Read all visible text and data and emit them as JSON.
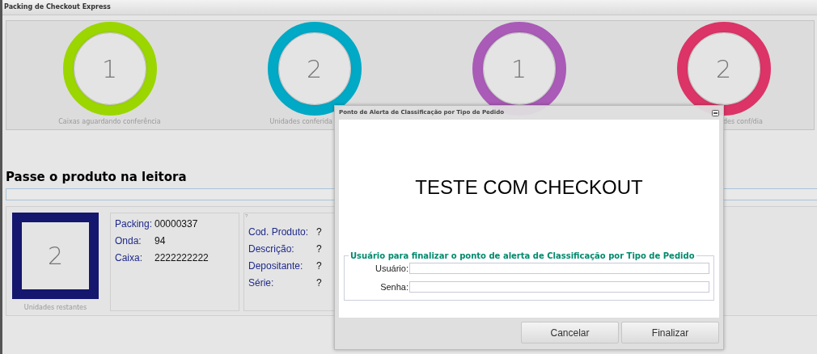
{
  "window": {
    "title": "Packing de Checkout Express"
  },
  "gauges": [
    {
      "value": "1",
      "label": "Caixas aguardando conferência",
      "color": "#9bd600"
    },
    {
      "value": "2",
      "label": "Unidades conferida",
      "color": "#00a9c6"
    },
    {
      "value": "1",
      "color": "#a95bb7"
    },
    {
      "value": "2",
      "label": "des conf/dia",
      "color": "#dc3467"
    }
  ],
  "scan": {
    "heading": "Passe o produto na leitora"
  },
  "remaining": {
    "value": "2",
    "label": "Unidades restantes"
  },
  "packing": [
    {
      "label": "Packing:",
      "value": "00000337"
    },
    {
      "label": "Onda:",
      "value": "94"
    },
    {
      "label": "Caixa:",
      "value": "2222222222"
    }
  ],
  "product": {
    "marker": "?",
    "fields": [
      {
        "label": "Cod. Produto:",
        "value": "?"
      },
      {
        "label": "Descrição:",
        "value": "?"
      },
      {
        "label": "Depositante:",
        "value": "?"
      },
      {
        "label": "Série:",
        "value": "?"
      }
    ]
  },
  "dialog": {
    "title": "Ponto de Alerta de Classificação por Tipo de Pedido",
    "message": "TESTE COM CHECKOUT",
    "fieldset": {
      "legend": "Usuário para finalizar o ponto de alerta de Classificação por Tipo de Pedido",
      "fields": [
        {
          "label": "Usuário:"
        },
        {
          "label": "Senha:"
        }
      ]
    },
    "buttons": [
      "Cancelar",
      "Finalizar"
    ]
  }
}
